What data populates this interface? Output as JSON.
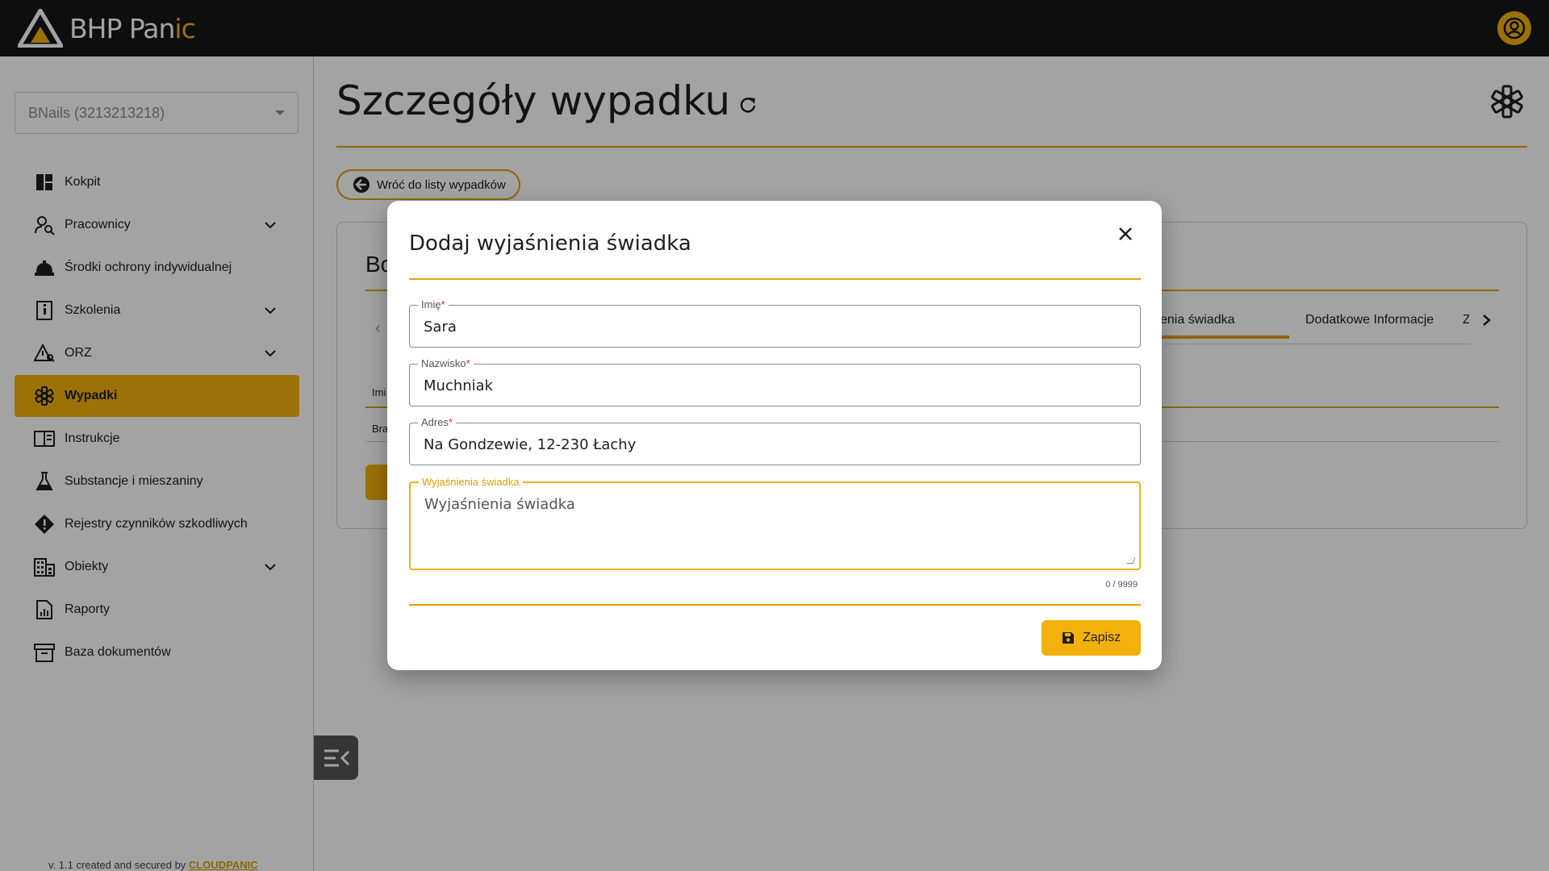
{
  "app": {
    "name_main": "BHP Pan",
    "name_accent": "ic"
  },
  "header": {
    "user_icon": "account-circle-icon"
  },
  "sidebar": {
    "company_select": "BNails (3213213218)",
    "items": [
      {
        "label": "Kokpit",
        "icon": "dashboard-icon",
        "expandable": false
      },
      {
        "label": "Pracownicy",
        "icon": "user-search-icon",
        "expandable": true
      },
      {
        "label": "Środki ochrony indywidualnej",
        "icon": "helmet-icon",
        "expandable": false
      },
      {
        "label": "Szkolenia",
        "icon": "info-book-icon",
        "expandable": true
      },
      {
        "label": "ORZ",
        "icon": "warning-search-icon",
        "expandable": true
      },
      {
        "label": "Wypadki",
        "icon": "star-of-life-icon",
        "expandable": false,
        "active": true
      },
      {
        "label": "Instrukcje",
        "icon": "book-open-icon",
        "expandable": false
      },
      {
        "label": "Substancje i mieszaniny",
        "icon": "flask-icon",
        "expandable": false
      },
      {
        "label": "Rejestry czynników szkodliwych",
        "icon": "alert-diamond-icon",
        "expandable": false
      },
      {
        "label": "Obiekty",
        "icon": "building-icon",
        "expandable": true
      },
      {
        "label": "Raporty",
        "icon": "report-icon",
        "expandable": false
      },
      {
        "label": "Baza dokumentów",
        "icon": "archive-icon",
        "expandable": false
      }
    ],
    "footer_text": "v. 1.1 created and secured by ",
    "footer_link": "CLOUDPANIC"
  },
  "main": {
    "title": "Szczegóły wypadku",
    "back_button": "Wróć do listy wypadków",
    "card_title_partial": "Bo",
    "tabs": [
      "enia świadka",
      "Dodatkowe Informacje",
      "Z"
    ],
    "table_header_partial": "Imi",
    "table_cell_partial": "Bra"
  },
  "dialog": {
    "title": "Dodaj wyjaśnienia świadka",
    "fields": {
      "first_name": {
        "label": "Imię",
        "value": "Sara",
        "required": "*"
      },
      "last_name": {
        "label": "Nazwisko",
        "value": "Muchniak",
        "required": "*"
      },
      "address": {
        "label": "Adres",
        "value": "Na Gondzewie, 12-230 Łachy",
        "required": "*"
      },
      "explanation": {
        "label": "Wyjaśnienia świadka",
        "placeholder": "Wyjaśnienia świadka"
      }
    },
    "counter": "0 / 9999",
    "save_button": "Zapisz"
  },
  "colors": {
    "accent": "#f4b10b",
    "accent_dark": "#e2a100",
    "topbar": "#161616",
    "overlay": "rgba(0,0,0,0.36)"
  }
}
